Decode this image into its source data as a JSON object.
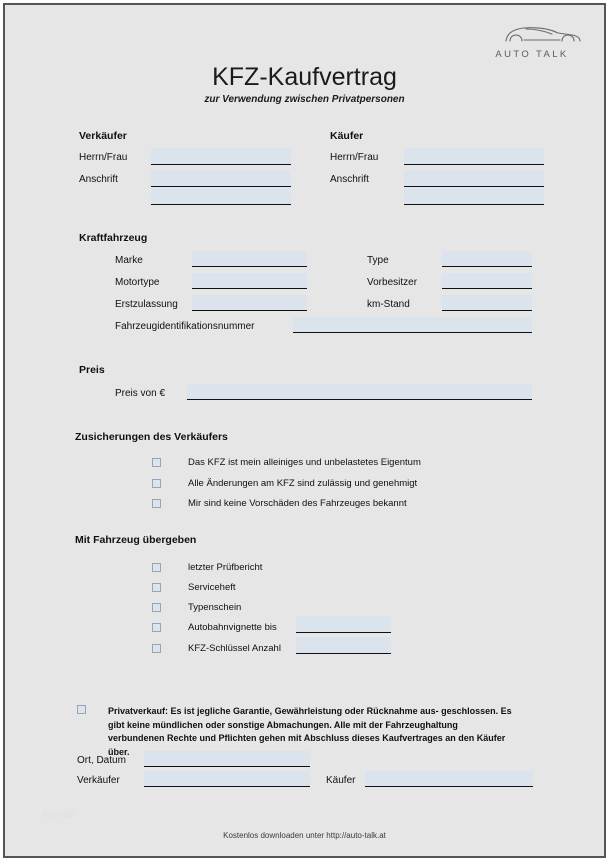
{
  "logo": {
    "icon": "car-outline-icon",
    "brand": "AUTO TALK"
  },
  "document": {
    "title": "KFZ-Kaufvertrag",
    "subtitle": "zur Verwendung zwischen Privatpersonen"
  },
  "parties": {
    "seller": {
      "heading": "Verkäufer",
      "name_label": "Herrn/Frau",
      "name_value": "",
      "address_label": "Anschrift",
      "address_line1": "",
      "address_line2": ""
    },
    "buyer": {
      "heading": "Käufer",
      "name_label": "Herrn/Frau",
      "name_value": "",
      "address_label": "Anschrift",
      "address_line1": "",
      "address_line2": ""
    }
  },
  "vehicle": {
    "heading": "Kraftfahrzeug",
    "marke_label": "Marke",
    "marke_value": "",
    "type_label": "Type",
    "type_value": "",
    "motortype_label": "Motortype",
    "motortype_value": "",
    "vorbesitzer_label": "Vorbesitzer",
    "vorbesitzer_value": "",
    "erstzulassung_label": "Erstzulassung",
    "erstzulassung_value": "",
    "km_label": "km-Stand",
    "km_value": "",
    "vin_label": "Fahrzeugidentifikationsnummer",
    "vin_value": ""
  },
  "price": {
    "heading": "Preis",
    "label": "Preis von €",
    "value": ""
  },
  "assurances": {
    "heading": "Zusicherungen des Verkäufers",
    "items": [
      {
        "label": "Das KFZ ist mein alleiniges und unbelastetes Eigentum",
        "checked": false
      },
      {
        "label": "Alle Änderungen am KFZ sind zulässig und genehmigt",
        "checked": false
      },
      {
        "label": "Mir sind keine Vorschäden des Fahrzeuges bekannt",
        "checked": false
      }
    ]
  },
  "handover": {
    "heading": "Mit Fahrzeug übergeben",
    "items": [
      {
        "label": "letzter Prüfbericht",
        "checked": false,
        "has_input": false,
        "value": ""
      },
      {
        "label": "Serviceheft",
        "checked": false,
        "has_input": false,
        "value": ""
      },
      {
        "label": "Typenschein",
        "checked": false,
        "has_input": false,
        "value": ""
      },
      {
        "label": "Autobahnvignette bis",
        "checked": false,
        "has_input": true,
        "value": ""
      },
      {
        "label": "KFZ-Schlüssel Anzahl",
        "checked": false,
        "has_input": true,
        "value": ""
      }
    ]
  },
  "legal": {
    "checked": false,
    "text": "Privatverkauf: Es ist jegliche Garantie, Gewährleistung oder Rücknahme aus- geschlossen. Es gibt keine mündlichen oder sonstige Abmachungen. Alle mit der Fahrzeughaltung verbundenen Rechte und Pflichten gehen mit Abschluss dieses Kaufvertrages an den Käufer über."
  },
  "signatures": {
    "place_date_label": "Ort, Datum",
    "place_date_value": "",
    "seller_label": "Verkäufer",
    "seller_value": "",
    "buyer_label": "Käufer",
    "buyer_value": ""
  },
  "footer": {
    "text": "Kostenlos downloaden unter http://auto-talk.at",
    "watermark": "eryweb"
  },
  "colors": {
    "page_background": "#e6e6e6",
    "frame_border": "#555558",
    "input_fill": "#dbe3ec",
    "input_underline": "#111111",
    "checkbox_border": "#9aa4b2",
    "text": "#101010"
  }
}
